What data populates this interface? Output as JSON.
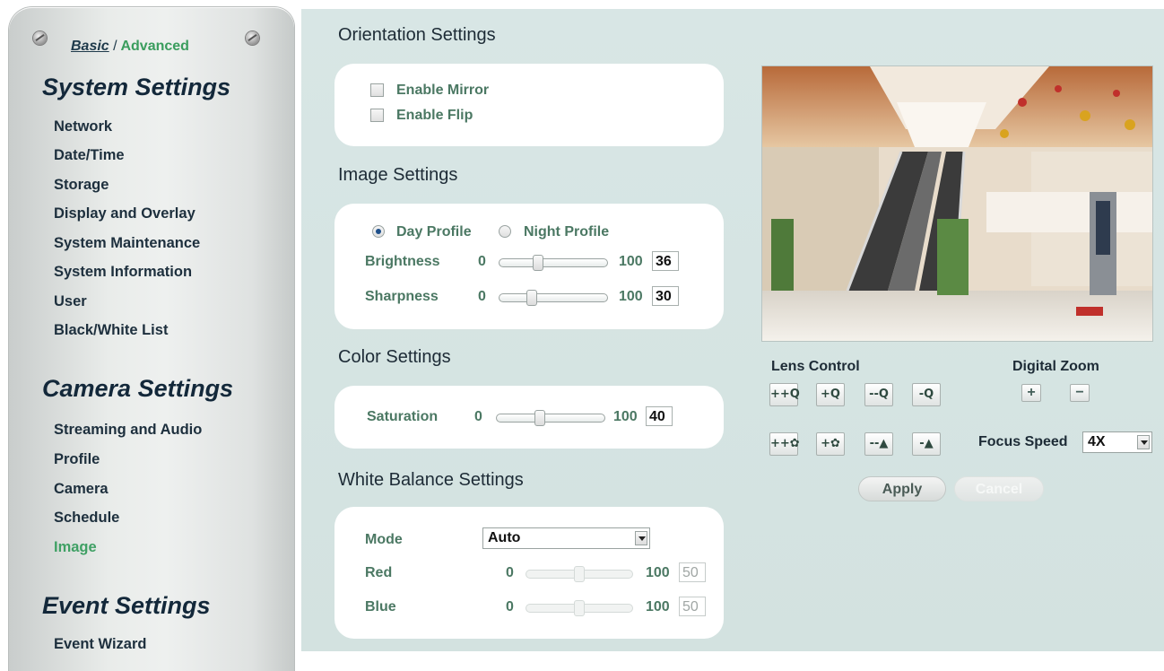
{
  "sidebar": {
    "mode": {
      "basic": "Basic",
      "separator": "/",
      "advanced": "Advanced"
    },
    "sections": [
      {
        "title": "System Settings",
        "items": [
          "Network",
          "Date/Time",
          "Storage",
          "Display and Overlay",
          "System Maintenance",
          "System Information",
          "User",
          "Black/White List"
        ]
      },
      {
        "title": "Camera Settings",
        "items": [
          "Streaming and Audio",
          "Profile",
          "Camera",
          "Schedule",
          "Image"
        ]
      },
      {
        "title": "Event Settings",
        "items": [
          "Event Wizard"
        ]
      }
    ],
    "active_item": "Image"
  },
  "orientation": {
    "heading": "Orientation Settings",
    "mirror_label": "Enable Mirror",
    "mirror_checked": false,
    "flip_label": "Enable Flip",
    "flip_checked": false
  },
  "image": {
    "heading": "Image Settings",
    "day_profile": "Day Profile",
    "night_profile": "Night Profile",
    "selected_profile": "day",
    "brightness": {
      "label": "Brightness",
      "min": "0",
      "max": "100",
      "value": "36"
    },
    "sharpness": {
      "label": "Sharpness",
      "min": "0",
      "max": "100",
      "value": "30"
    }
  },
  "color": {
    "heading": "Color Settings",
    "saturation": {
      "label": "Saturation",
      "min": "0",
      "max": "100",
      "value": "40"
    }
  },
  "white_balance": {
    "heading": "White Balance Settings",
    "mode_label": "Mode",
    "mode_value": "Auto",
    "red": {
      "label": "Red",
      "min": "0",
      "max": "100",
      "value": "50"
    },
    "blue": {
      "label": "Blue",
      "min": "0",
      "max": "100",
      "value": "50"
    }
  },
  "lens": {
    "title": "Lens Control",
    "zoom_buttons": [
      "++Q",
      "+Q",
      "--Q",
      "-Q"
    ],
    "focus_buttons": [
      "++✿",
      "+✿",
      "--▲",
      "-▲"
    ]
  },
  "digital_zoom": {
    "title": "Digital Zoom",
    "plus": "+",
    "minus": "−"
  },
  "focus_speed": {
    "label": "Focus Speed",
    "value": "4X"
  },
  "actions": {
    "apply": "Apply",
    "cancel": "Cancel"
  },
  "colors": {
    "accent_green": "#3fa064",
    "label_green": "#4b7863",
    "panel_bg": "#d8e6e5"
  }
}
